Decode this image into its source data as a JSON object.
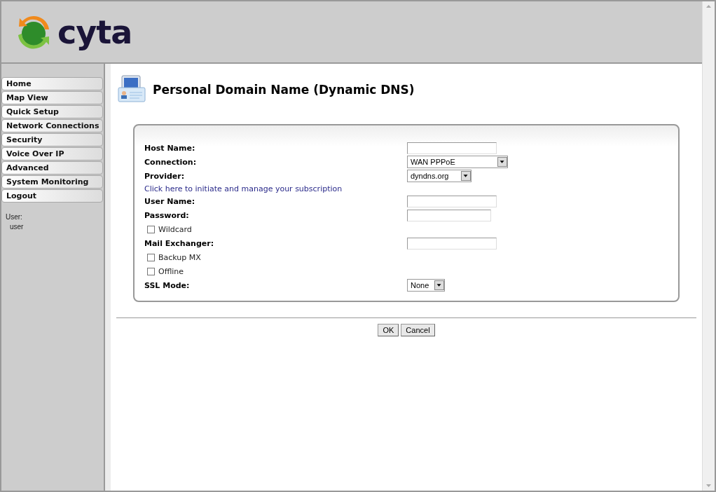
{
  "header": {
    "logo_text": "cyta"
  },
  "sidebar": {
    "items": [
      {
        "label": "Home",
        "selected": false
      },
      {
        "label": "Map View",
        "selected": false
      },
      {
        "label": "Quick Setup",
        "selected": false
      },
      {
        "label": "Network Connections",
        "selected": false
      },
      {
        "label": "Security",
        "selected": false
      },
      {
        "label": "Voice Over IP",
        "selected": false
      },
      {
        "label": "Advanced",
        "selected": false
      },
      {
        "label": "System Monitoring",
        "selected": false
      },
      {
        "label": "Logout",
        "selected": false
      }
    ],
    "user_label": "User:",
    "user_name": "user"
  },
  "page": {
    "title": "Personal Domain Name (Dynamic DNS)"
  },
  "form": {
    "rows": [
      {
        "kind": "text",
        "label": "Host Name:",
        "value": ""
      },
      {
        "kind": "select",
        "label": "Connection:",
        "value": "WAN PPPoE"
      },
      {
        "kind": "select",
        "label": "Provider:",
        "value": "dyndns.org"
      },
      {
        "kind": "link",
        "label": "Click here to initiate and manage your subscription"
      },
      {
        "kind": "text",
        "label": "User Name:",
        "value": ""
      },
      {
        "kind": "text",
        "label": "Password:",
        "value": ""
      },
      {
        "kind": "checkbox",
        "label": "Wildcard",
        "checked": false
      },
      {
        "kind": "text",
        "label": "Mail Exchanger:",
        "value": ""
      },
      {
        "kind": "checkbox",
        "label": "Backup MX",
        "checked": false
      },
      {
        "kind": "checkbox",
        "label": "Offline",
        "checked": false
      },
      {
        "kind": "select",
        "label": "SSL Mode:",
        "value": "None"
      }
    ]
  },
  "buttons": [
    "OK",
    "Cancel"
  ]
}
